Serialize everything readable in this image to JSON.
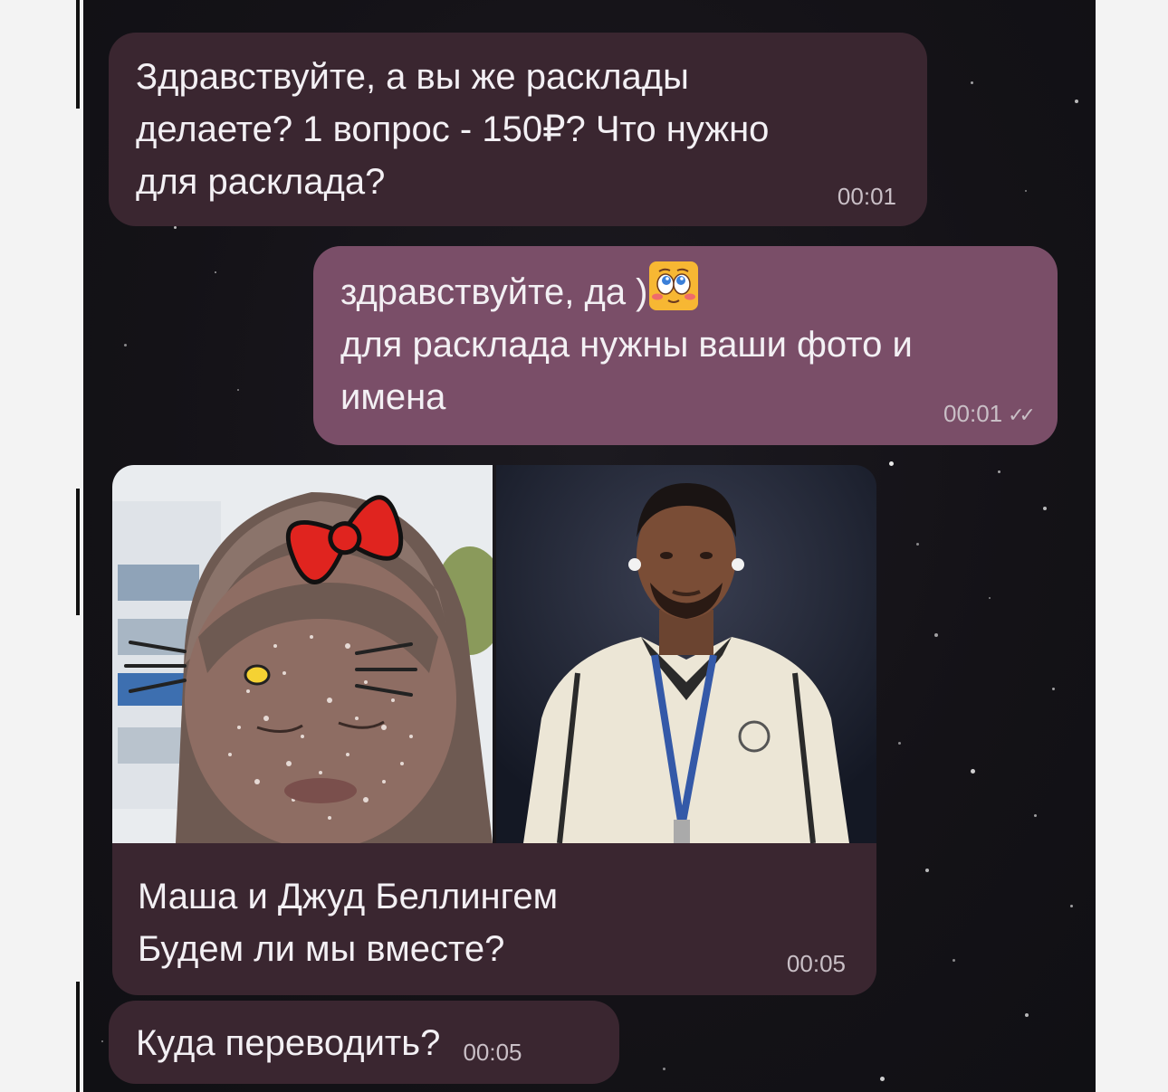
{
  "chat": {
    "messages": [
      {
        "direction": "incoming",
        "text": "Здравствуйте, а вы же расклады\nделаете? 1 вопрос - 150₽? Что нужно\nдля расклада?",
        "time": "00:01"
      },
      {
        "direction": "outgoing",
        "line1": "здравствуйте, да )",
        "emoji": "blushing-emoji",
        "text": "для расклада нужны ваши фото и\nимена",
        "time": "00:01",
        "status": "read-double-check"
      },
      {
        "direction": "incoming",
        "photos": [
          "photo-girl-with-hello-kitty-filter",
          "photo-football-player"
        ],
        "text": "Маша и Джуд Беллингем\nБудем ли мы вместе?",
        "time": "00:05"
      },
      {
        "direction": "incoming",
        "text": "Куда переводить?",
        "time": "00:05"
      }
    ]
  },
  "colors": {
    "background": "#141217",
    "incoming_bubble": "#3a2630",
    "outgoing_bubble": "#7a4e68",
    "text": "#f3f0f4",
    "time": "#c9bfc6"
  }
}
